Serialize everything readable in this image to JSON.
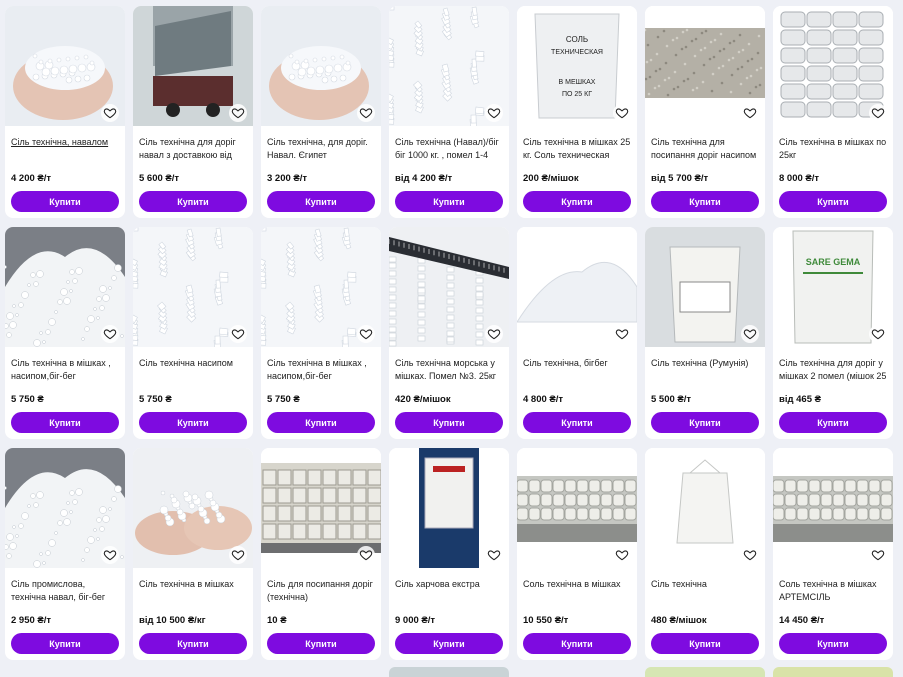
{
  "buy_label": "Купити",
  "accent_color": "#7e0be0",
  "products": [
    {
      "title": "Сіль технічна, навалом",
      "price": "4 200 ₴/т",
      "img": "hand"
    },
    {
      "title": "Сіль технічна для доріг навал з доставкою від 24т.",
      "price": "5 600 ₴/т",
      "img": "truck"
    },
    {
      "title": "Сіль технічна, для доріг. Навал. Єгипет",
      "price": "3 200 ₴/т",
      "img": "hand"
    },
    {
      "title": "Сіль технічна (Навал)/біг біг 1000 кг. , помел 1-4",
      "price": "від 4 200 ₴/т",
      "img": "crystals"
    },
    {
      "title": "Сіль технічна в мішках 25 кг. Соль техническая",
      "price": "200 ₴/мішок",
      "img": "bag_text"
    },
    {
      "title": "Сіль технічна для посипання доріг насипом",
      "price": "від 5 700 ₴/т",
      "img": "gravel"
    },
    {
      "title": "Сіль технічна в мішках по 25кг",
      "price": "8 000 ₴/т",
      "img": "bags"
    },
    {
      "title": "Сіль технічна в мішках , насипом,біг-бег",
      "price": "5 750 ₴",
      "img": "pile"
    },
    {
      "title": "Сіль технічна насипом",
      "price": "5 750 ₴",
      "img": "crystals"
    },
    {
      "title": "Сіль технічна в мішках , насипом,біг-бег",
      "price": "5 750 ₴",
      "img": "crystals"
    },
    {
      "title": "Сіль технічна морська у мішках. Помел №3. 25кг",
      "price": "420 ₴/мішок",
      "img": "ruler"
    },
    {
      "title": "Сіль технічна, бігбег",
      "price": "4 800 ₴/т",
      "img": "mound"
    },
    {
      "title": "Сіль технічна (Румунія)",
      "price": "5 500 ₴/т",
      "img": "sack"
    },
    {
      "title": "Сіль технічна для доріг у мішках 2 помел (мішок 25",
      "price": "від 465 ₴",
      "img": "sack_green"
    },
    {
      "title": "Сіль промислова, технічна навал, біг-бег",
      "price": "2 950 ₴/т",
      "img": "pile"
    },
    {
      "title": "Сіль технічна в мішках",
      "price": "від 10 500 ₴/кг",
      "img": "hands"
    },
    {
      "title": "Сіль для посипання доріг (технічна)",
      "price": "10 ₴",
      "img": "warehouse"
    },
    {
      "title": "Сіль харчова екстра",
      "price": "9 000 ₴/т",
      "img": "bigbags"
    },
    {
      "title": "Соль технічна в мішках",
      "price": "10 550 ₴/т",
      "img": "storage"
    },
    {
      "title": "Сіль технічна",
      "price": "480 ₴/мішок",
      "img": "whitebag"
    },
    {
      "title": "Соль технічна в мішках АРТЕМСІЛЬ",
      "price": "14 450 ₴/т",
      "img": "storage"
    }
  ],
  "stubs": [
    {
      "color": "#c9d3d6"
    },
    {
      "color": "#d6e6b3"
    },
    {
      "color": "#d9e3a8"
    }
  ],
  "image_labels": {
    "bag_text": "СОЛЬ ТЕХНИЧЕСКАЯ В МЕШКАХ ПО 25 КГ",
    "sack_green": "SARE GEMA"
  }
}
